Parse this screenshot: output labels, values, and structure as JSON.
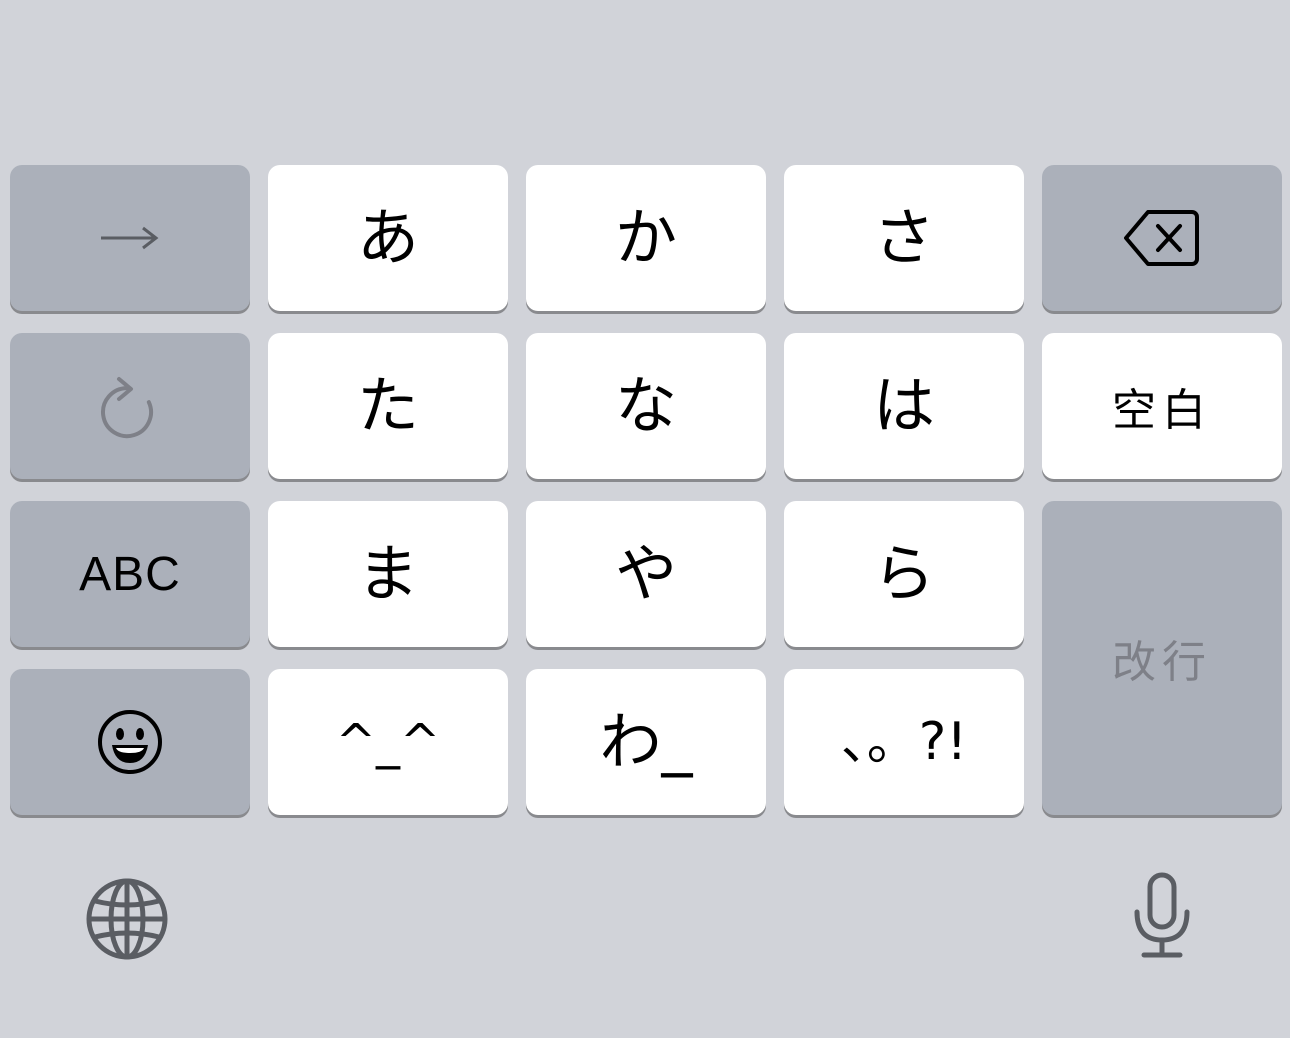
{
  "keyboard": {
    "row1": {
      "left_icon": "right-arrow-icon",
      "k1": "あ",
      "k2": "か",
      "k3": "さ",
      "right_icon": "delete-backspace-icon"
    },
    "row2": {
      "left_icon": "undo-icon",
      "k1": "た",
      "k2": "な",
      "k3": "は",
      "space": "空白"
    },
    "row3": {
      "abc": "ABC",
      "k1": "ま",
      "k2": "や",
      "k3": "ら",
      "return": "改行"
    },
    "row4": {
      "left_icon": "emoji-icon",
      "k1": "^_^",
      "k2": "わ_",
      "k3": "、。?!"
    },
    "bottom": {
      "left_icon": "globe-icon",
      "right_icon": "microphone-icon"
    },
    "colors": {
      "background": "#d1d3d9",
      "light_key": "#ffffff",
      "dark_key": "#abb0ba",
      "icon_gray": "#5a5d63"
    }
  }
}
